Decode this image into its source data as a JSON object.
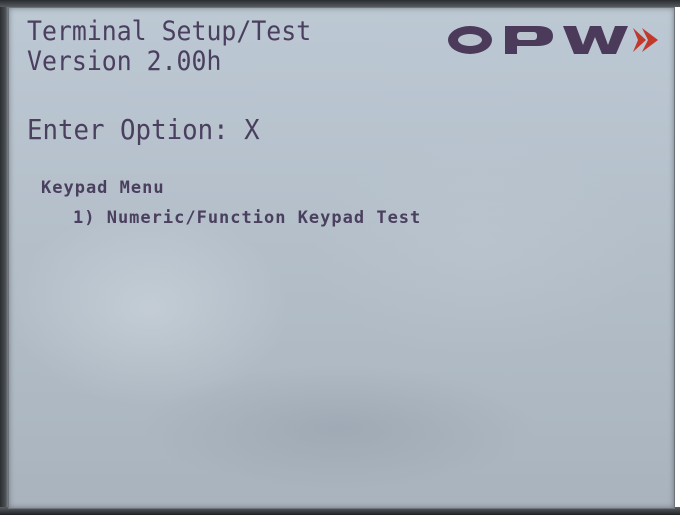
{
  "terminal": {
    "title": "Terminal Setup/Test",
    "version": "Version 2.00h",
    "prompt": "Enter Option: X",
    "logo_text": "OPW",
    "logo_color": "#4b3a5a",
    "logo_arrow_color": "#c0392b"
  },
  "menu": {
    "title": "Keypad Menu",
    "items": [
      {
        "label": "1) Numeric/Function Keypad Test"
      }
    ]
  },
  "colors": {
    "screen_bg": "#b6c1cc",
    "text": "#4a3f5e"
  }
}
